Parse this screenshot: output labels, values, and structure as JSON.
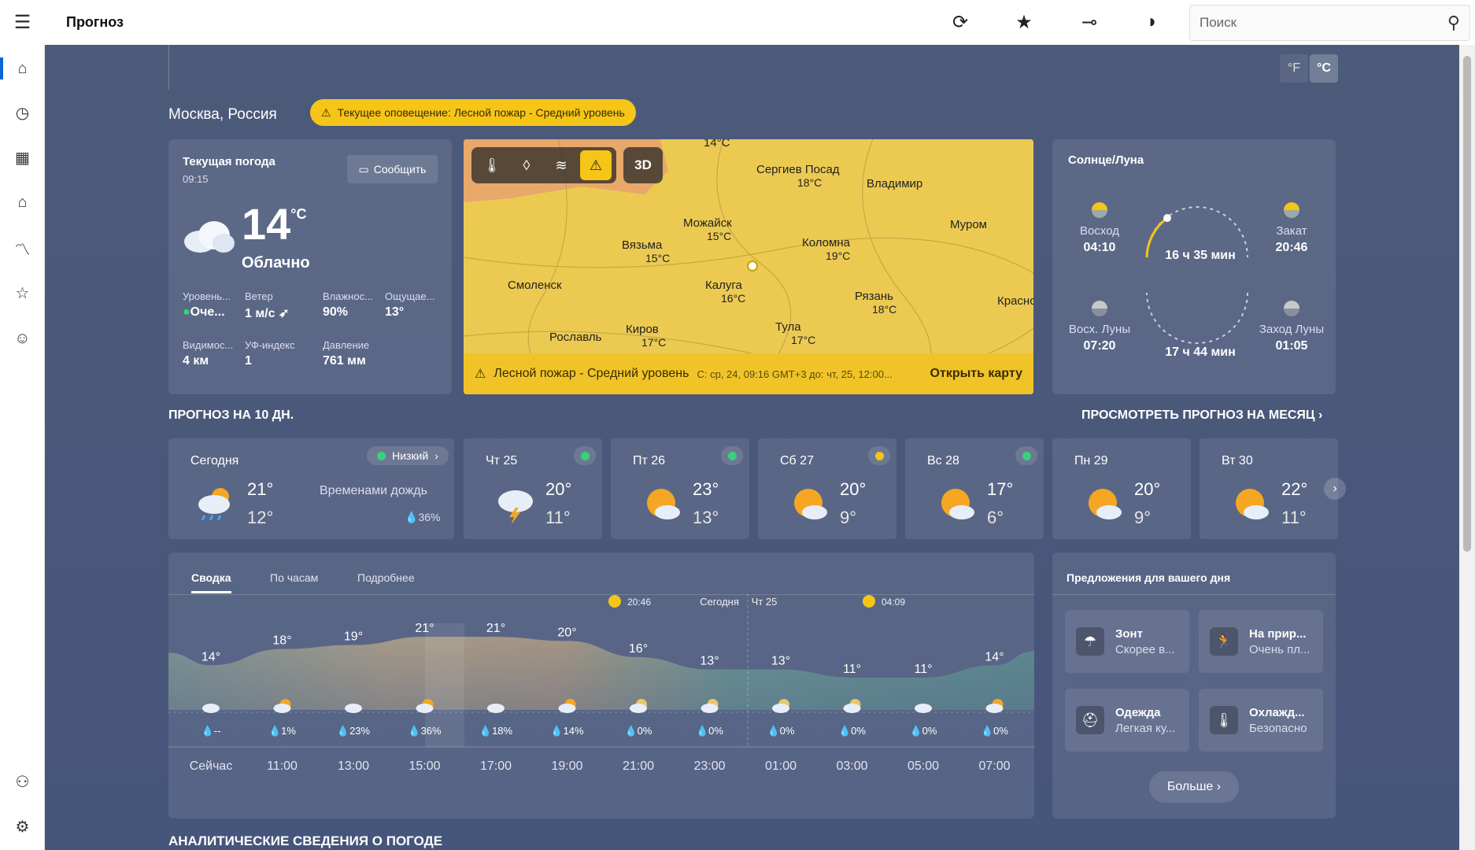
{
  "app": {
    "title": "Прогноз"
  },
  "toolbar": {
    "search_placeholder": "Поиск"
  },
  "units": {
    "f": "°F",
    "c": "°C"
  },
  "location": "Москва, Россия",
  "alert": "Текущее оповещение: Лесной пожар - Средний уровень",
  "current": {
    "title": "Текущая погода",
    "time": "09:15",
    "report": "Сообщить",
    "temp": "14",
    "unit": "°C",
    "condition": "Облачно",
    "details": [
      {
        "label": "Уровень...",
        "value": "Оче..."
      },
      {
        "label": "Ветер",
        "value": "1 м/с"
      },
      {
        "label": "Влажнос...",
        "value": "90%"
      },
      {
        "label": "Ощущае...",
        "value": "13°"
      },
      {
        "label": "Видимос...",
        "value": "4 км"
      },
      {
        "label": "УФ-индекс",
        "value": "1"
      },
      {
        "label": "Давление",
        "value": "761 мм"
      }
    ]
  },
  "map": {
    "mode3d": "3D",
    "cities": [
      {
        "name": "Сергиев Посад",
        "temp": "18°C"
      },
      {
        "name": "Владимир",
        "temp": ""
      },
      {
        "name": "Можайск",
        "temp": "15°C"
      },
      {
        "name": "Коломна",
        "temp": "19°C"
      },
      {
        "name": "Муром",
        "temp": ""
      },
      {
        "name": "Вязьма",
        "temp": "15°C"
      },
      {
        "name": "Смоленск",
        "temp": ""
      },
      {
        "name": "Калуга",
        "temp": "16°C"
      },
      {
        "name": "Рязань",
        "temp": "18°C"
      },
      {
        "name": "Рославль",
        "temp": ""
      },
      {
        "name": "Киров",
        "temp": "17°C"
      },
      {
        "name": "Тула",
        "temp": "17°C"
      },
      {
        "name": "Красно",
        "temp": ""
      },
      {
        "name": "14°C",
        "temp": ""
      }
    ],
    "bar_title": "Лесной пожар - Средний уровень",
    "bar_period": "С: ср, 24, 09:16 GMT+3 до: чт, 25, 12:00...",
    "open": "Открыть карту"
  },
  "sun": {
    "title": "Солнце/Луна",
    "sunrise_label": "Восход",
    "sunrise": "04:10",
    "sunset_label": "Закат",
    "sunset": "20:46",
    "day_len": "16 ч 35 мин",
    "moonrise_label": "Восх. Луны",
    "moonrise": "07:20",
    "moonset_label": "Заход Луны",
    "moonset": "01:05",
    "moon_len": "17 ч 44 мин"
  },
  "forecast_title": "ПРОГНОЗ НА 10 ДН.",
  "month_link": "ПРОСМОТРЕТЬ ПРОГНОЗ НА МЕСЯЦ",
  "today": {
    "name": "Сегодня",
    "hi": "21°",
    "lo": "12°",
    "pollen": "Низкий",
    "desc": "Временами дождь",
    "precip": "36%"
  },
  "days": [
    {
      "name": "Чт 25",
      "hi": "20°",
      "lo": "11°",
      "icon": "thunder-rain-icon"
    },
    {
      "name": "Пт 26",
      "hi": "23°",
      "lo": "13°",
      "icon": "partly-sunny-icon"
    },
    {
      "name": "Сб 27",
      "hi": "20°",
      "lo": "9°",
      "icon": "partly-sunny-icon"
    },
    {
      "name": "Вс 28",
      "hi": "17°",
      "lo": "6°",
      "icon": "partly-sunny-icon"
    },
    {
      "name": "Пн 29",
      "hi": "20°",
      "lo": "9°",
      "icon": "partly-sunny-icon"
    },
    {
      "name": "Вт 30",
      "hi": "22°",
      "lo": "11°",
      "icon": "partly-cloudy-icon"
    }
  ],
  "summary": {
    "tabs": [
      "Сводка",
      "По часам",
      "Подробнее"
    ],
    "sunset": "20:46",
    "today": "Сегодня",
    "nextday": "Чт 25",
    "sunrise": "04:09",
    "temps": [
      "14°",
      "18°",
      "19°",
      "21°",
      "21°",
      "20°",
      "16°",
      "13°",
      "13°",
      "11°",
      "11°",
      "14°"
    ],
    "precip": [
      "--",
      "1%",
      "23%",
      "36%",
      "18%",
      "14%",
      "0%",
      "0%",
      "0%",
      "0%",
      "0%",
      "0%"
    ],
    "times": [
      "Сейчас",
      "11:00",
      "13:00",
      "15:00",
      "17:00",
      "19:00",
      "21:00",
      "23:00",
      "01:00",
      "03:00",
      "05:00",
      "07:00"
    ]
  },
  "suggestions": {
    "title": "Предложения для вашего дня",
    "items": [
      {
        "title": "Зонт",
        "sub": "Скорее в..."
      },
      {
        "title": "На прир...",
        "sub": "Очень пл..."
      },
      {
        "title": "Одежда",
        "sub": "Легкая ку..."
      },
      {
        "title": "Охлажд...",
        "sub": "Безопасно"
      }
    ],
    "more": "Больше"
  },
  "analytics_title": "АНАЛИТИЧЕСКИЕ СВЕДЕНИЯ О ПОГОДЕ",
  "colors": {
    "accent": "#0b66d6",
    "alert": "#f5c518",
    "map": "#e9c84e"
  }
}
